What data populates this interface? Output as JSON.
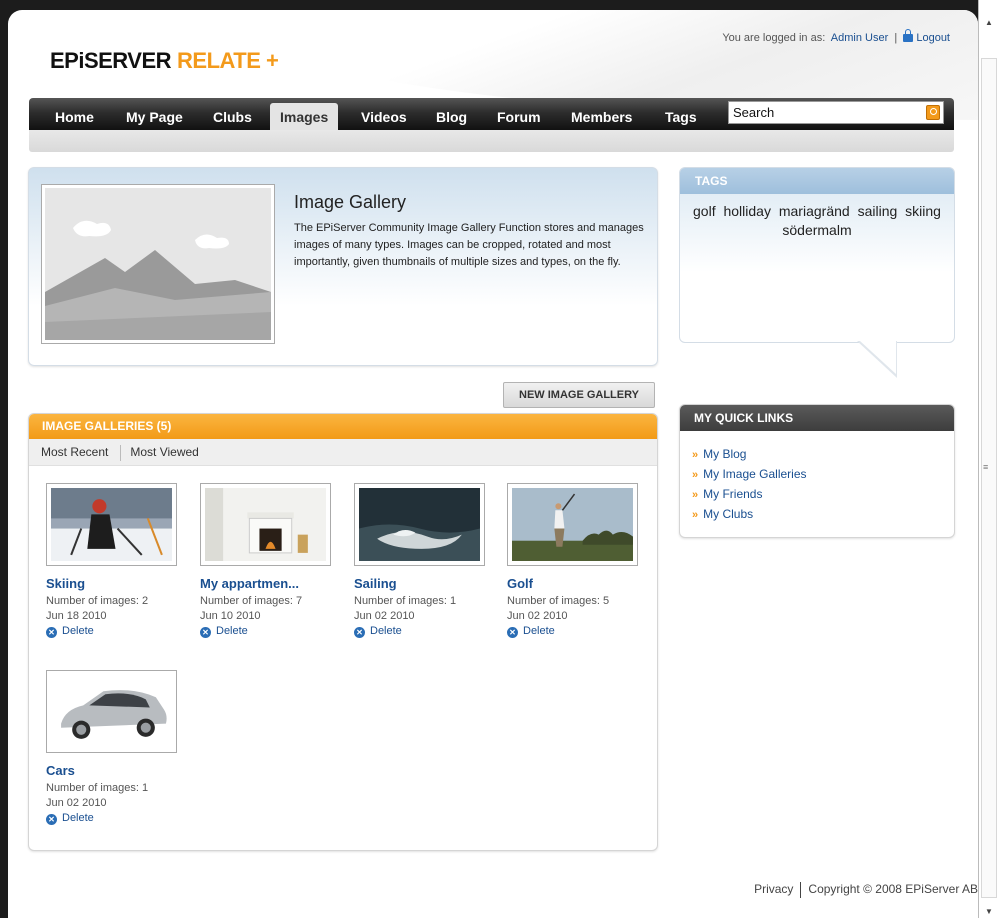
{
  "logo": {
    "part1": "EPiSERVER",
    "part2": "RELATE +"
  },
  "login": {
    "prefix": "You are logged in as:",
    "user": "Admin User",
    "logout": "Logout"
  },
  "nav": [
    "Home",
    "My Page",
    "Clubs",
    "Images",
    "Videos",
    "Blog",
    "Forum",
    "Members",
    "Tags"
  ],
  "nav_active": "Images",
  "search": {
    "value": "Search"
  },
  "hero": {
    "title": "Image Gallery",
    "text": "The EPiServer Community Image Gallery Function stores and manages images of many types. Images can be cropped, rotated and most importantly, given thumbnails of multiple sizes and types, on the fly."
  },
  "new_gallery_button": "NEW IMAGE GALLERY",
  "galleries": {
    "header": "IMAGE GALLERIES (5)",
    "tabs": [
      "Most Recent",
      "Most Viewed"
    ],
    "delete_label": "Delete",
    "items": [
      {
        "name": "Skiing",
        "count": "Number of images: 2",
        "date": "Jun 18 2010"
      },
      {
        "name": "My appartmen...",
        "count": "Number of images: 7",
        "date": "Jun 10 2010"
      },
      {
        "name": "Sailing",
        "count": "Number of images: 1",
        "date": "Jun 02 2010"
      },
      {
        "name": "Golf",
        "count": "Number of images: 5",
        "date": "Jun 02 2010"
      },
      {
        "name": "Cars",
        "count": "Number of images: 1",
        "date": "Jun 02 2010"
      }
    ]
  },
  "tags": {
    "header": "TAGS",
    "items": [
      "golf",
      "holliday",
      "mariagränd",
      "sailing",
      "skiing",
      "södermalm"
    ]
  },
  "quick_links": {
    "header": "MY QUICK LINKS",
    "items": [
      "My Blog",
      "My Image Galleries",
      "My Friends",
      "My Clubs"
    ]
  },
  "footer": {
    "privacy": "Privacy",
    "copyright": "Copyright © 2008 EPiServer AB"
  },
  "colors": {
    "accent": "#f39a1b",
    "link": "#1a4f90",
    "nav": "#2d2d2d"
  }
}
